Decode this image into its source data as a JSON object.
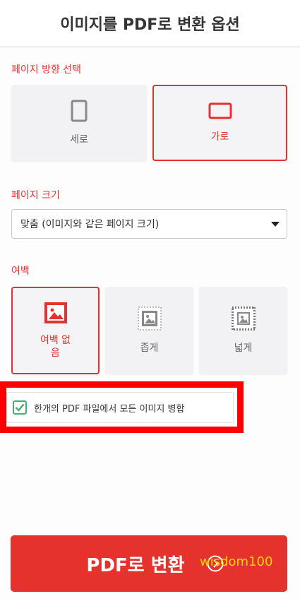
{
  "header": {
    "title": "이미지를 PDF로 변환 옵션"
  },
  "orientation": {
    "label": "페이지 방향 선택",
    "options": [
      {
        "label": "세로",
        "icon": "portrait-page-icon",
        "selected": false
      },
      {
        "label": "가로",
        "icon": "landscape-page-icon",
        "selected": true
      }
    ]
  },
  "page_size": {
    "label": "페이지 크기",
    "selected_value": "맞춤 (이미지와 같은 페이지 크기)"
  },
  "margin": {
    "label": "여백",
    "options": [
      {
        "label": "여백 없\n음",
        "icon": "no-margin-image-icon",
        "selected": true
      },
      {
        "label": "좁게",
        "icon": "small-margin-image-icon",
        "selected": false
      },
      {
        "label": "넓게",
        "icon": "big-margin-image-icon",
        "selected": false
      }
    ]
  },
  "merge": {
    "label": "한개의 PDF 파일에서 모든 이미지 병합",
    "checked": true
  },
  "convert_button": {
    "label": "PDF로 변환"
  },
  "watermark": "wisdom100",
  "colors": {
    "accent": "#e5322d",
    "check": "#3cb371",
    "highlight": "#ff0000"
  }
}
